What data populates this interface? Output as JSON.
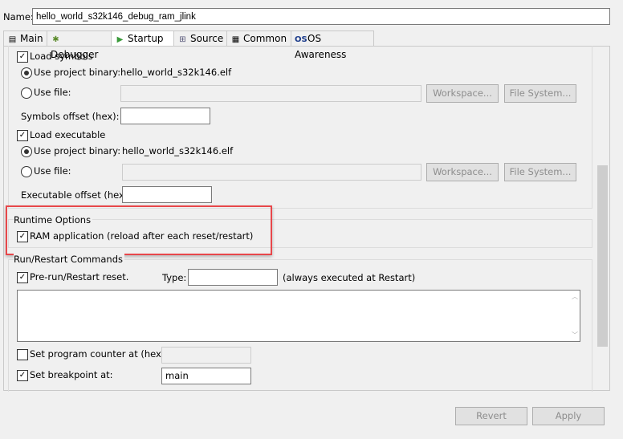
{
  "name": {
    "label": "Name:",
    "value": "hello_world_s32k146_debug_ram_jlink"
  },
  "tabs": [
    {
      "label": "Main",
      "icon": "document-icon"
    },
    {
      "label": "Debugger",
      "icon": "bug-icon"
    },
    {
      "label": "Startup",
      "icon": "play-icon"
    },
    {
      "label": "Source",
      "icon": "source-tree-icon"
    },
    {
      "label": "Common",
      "icon": "table-icon"
    },
    {
      "label": "OS Awareness",
      "icon": "os-icon"
    }
  ],
  "symbols": {
    "load": "Load symbols",
    "use_project": "Use project binary:",
    "project_value": "hello_world_s32k146.elf",
    "use_file": "Use file:",
    "workspace": "Workspace...",
    "filesystem": "File System...",
    "offset": "Symbols offset (hex):"
  },
  "executable": {
    "load": "Load executable",
    "use_project": "Use project binary:",
    "project_value": "hello_world_s32k146.elf",
    "use_file": "Use file:",
    "workspace": "Workspace...",
    "filesystem": "File System...",
    "offset": "Executable offset (hex):"
  },
  "runtime": {
    "title": "Runtime Options",
    "ram_app": "RAM application (reload after each reset/restart)"
  },
  "run": {
    "title": "Run/Restart Commands",
    "prerun": "Pre-run/Restart reset.",
    "type_label": "Type:",
    "type_value": "",
    "note": "(always executed at Restart)",
    "set_pc": "Set program counter at (hex):",
    "set_bp": "Set breakpoint at:",
    "bp_value": "main"
  },
  "buttons": {
    "revert": "Revert",
    "apply": "Apply"
  },
  "highlight_color": "#e8474a"
}
